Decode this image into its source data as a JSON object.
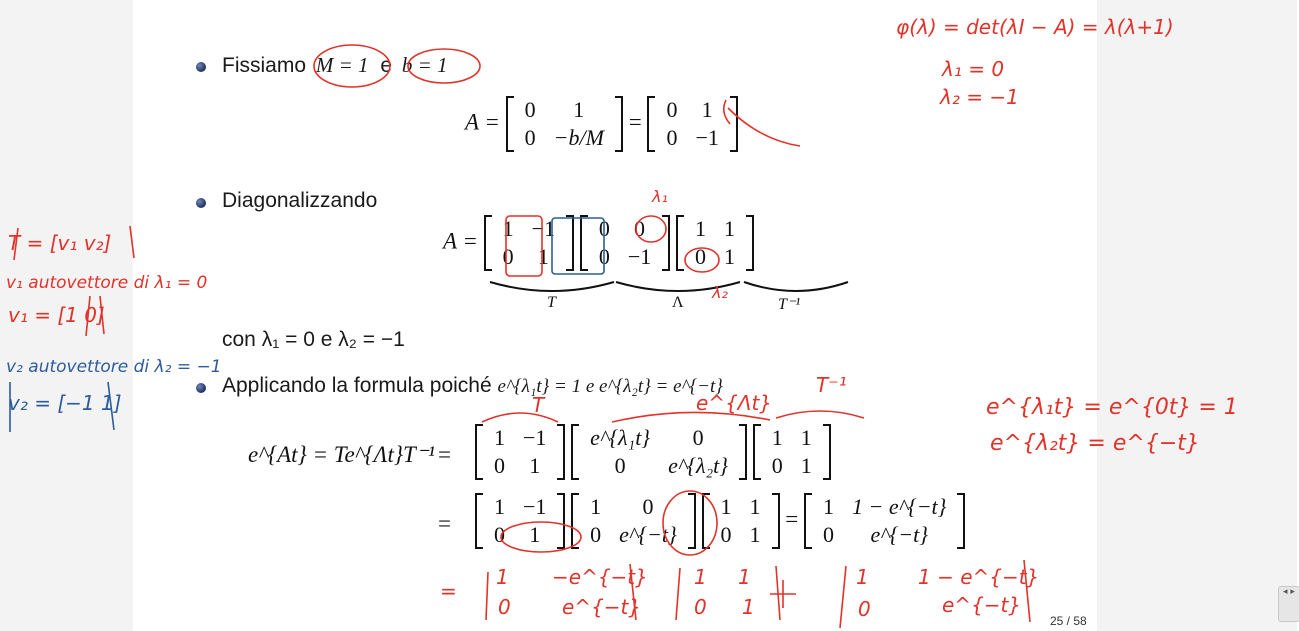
{
  "slide": {
    "bullet1_text": "Fissiamo",
    "bullet1_m": "M = 1",
    "bullet1_e": "e",
    "bullet1_b": "b = 1",
    "bullet2_text": "Diagonalizzando",
    "con_text": "con λ₁ = 0 e λ₂ = −1",
    "bullet3_text": "Applicando la formula poiché",
    "bullet3_math": "e^{λ₁t} = 1 e e^{λ₂t} = e^{−t}",
    "eq_A_lhs": "A =",
    "matA1": [
      [
        "0",
        "1"
      ],
      [
        "0",
        "−b/M"
      ]
    ],
    "eq_mid": "=",
    "matA2": [
      [
        "0",
        "1"
      ],
      [
        "0",
        "−1"
      ]
    ],
    "eq_diag_lhs": "A =",
    "matT": [
      [
        "1",
        "−1"
      ],
      [
        "0",
        "1"
      ]
    ],
    "matLambda": [
      [
        "0",
        "0"
      ],
      [
        "0",
        "−1"
      ]
    ],
    "matTinv": [
      [
        "1",
        "1"
      ],
      [
        "0",
        "1"
      ]
    ],
    "brace_T": "T",
    "brace_Lambda": "Λ",
    "brace_Tinv": "T⁻¹",
    "exp_lhs": "e^{At} = Te^{Λt}T⁻¹",
    "exp_eq1": "=",
    "matE1": [
      [
        "1",
        "−1"
      ],
      [
        "0",
        "1"
      ]
    ],
    "matE2": [
      [
        "e^{λ₁t}",
        "0"
      ],
      [
        "0",
        "e^{λ₂t}"
      ]
    ],
    "matE3": [
      [
        "1",
        "1"
      ],
      [
        "0",
        "1"
      ]
    ],
    "exp_eq2": "=",
    "matF1": [
      [
        "1",
        "−1"
      ],
      [
        "0",
        "1"
      ]
    ],
    "matF2": [
      [
        "1",
        "0"
      ],
      [
        "0",
        "e^{−t}"
      ]
    ],
    "matF3": [
      [
        "1",
        "1"
      ],
      [
        "0",
        "1"
      ]
    ],
    "exp_eq3": "=",
    "matF4": [
      [
        "1",
        "1 − e^{−t}"
      ],
      [
        "0",
        "e^{−t}"
      ]
    ],
    "page_number": "25 / 58"
  },
  "annotations": {
    "phi": "φ(λ) = det(λI − A) = λ(λ+1)",
    "lambda1": "λ₁ = 0",
    "lambda2": "λ₂ = −1",
    "T_def": "T = [v₁ v₂]",
    "v1_desc": "v₁ autovettore di λ₁ = 0",
    "v1_vec": "v₁ = [1 0]",
    "v2_desc": "v₂ autovettore di λ₂ = −1",
    "v2_vec": "v₂ = [−1 1]",
    "lam1_mark": "λ₁",
    "lam2_mark": "λ₂",
    "T_mark": "T",
    "elt_mark": "e^{Λt}",
    "Tinv_mark": "T⁻¹",
    "exp1": "e^{λ₁t} = e^{0t} = 1",
    "exp2": "e^{λ₂t} = e^{−t}",
    "result_row1": [
      "1",
      "−e^{−t}",
      "1",
      "1",
      "1",
      "1 − e^{−t}"
    ],
    "result_row2": [
      "0",
      "e^{−t}",
      "0",
      "1",
      "0",
      "e^{−t}"
    ]
  },
  "colors": {
    "red_ink": "#e0332a",
    "blue_ink": "#2c5c9c",
    "bullet": "#1e2f63"
  },
  "nav": {
    "label": "◂ ▸"
  }
}
